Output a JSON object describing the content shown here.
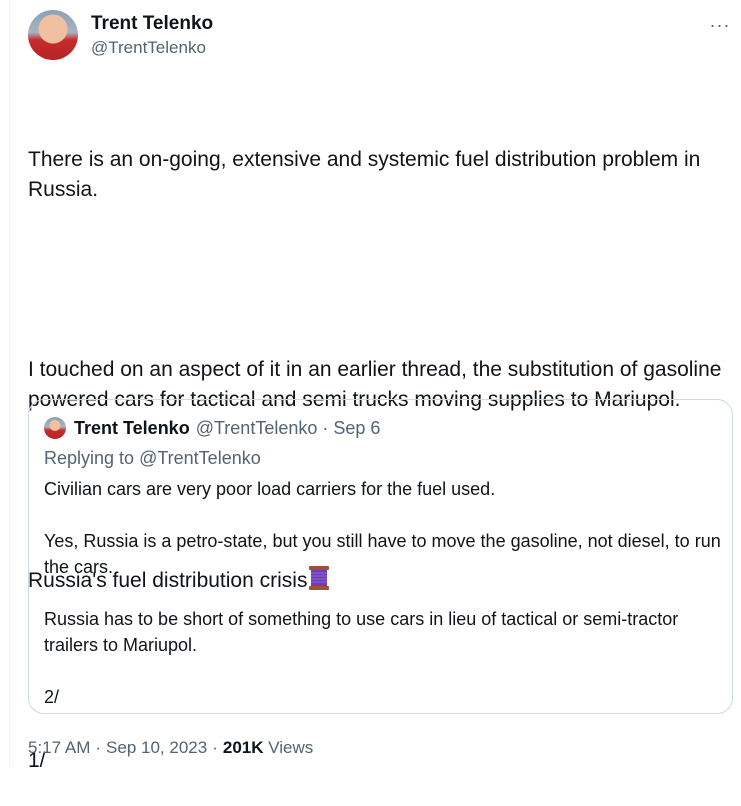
{
  "author": {
    "display_name": "Trent Telenko",
    "handle": "@TrentTelenko"
  },
  "menu": {
    "more_icon": "more-horizontal-icon",
    "more_label": "···"
  },
  "tweet": {
    "para1": "There is an on-going, extensive and systemic fuel distribution problem in Russia.",
    "para2": "I touched on an aspect of it in an earlier thread, the substitution of gasoline powered cars for tactical and semi trucks moving supplies to Mariupol.",
    "para3": "Russia's fuel distribution crisis",
    "para3_emoji": "thread-spool-icon",
    "para4": "1/"
  },
  "quote": {
    "display_name": "Trent Telenko",
    "handle": "@TrentTelenko",
    "separator": "·",
    "date": "Sep 6",
    "replying_prefix": "Replying to ",
    "replying_to": "@TrentTelenko",
    "p1": "Civilian cars are very poor load carriers for the fuel used.",
    "p2": "Yes, Russia is a petro-state, but you still have to move the gasoline, not diesel, to run the cars.",
    "p3": "Russia has to be short of something to use cars in lieu of tactical or semi-tractor trailers to Mariupol.",
    "p4": "2/"
  },
  "meta": {
    "time": "5:17 AM",
    "sep1": "·",
    "date": "Sep 10, 2023",
    "sep2": "·",
    "views_count": "201K",
    "views_label": "Views"
  },
  "colors": {
    "text": "#0f1419",
    "secondary": "#536471",
    "border": "#cfd9de"
  }
}
